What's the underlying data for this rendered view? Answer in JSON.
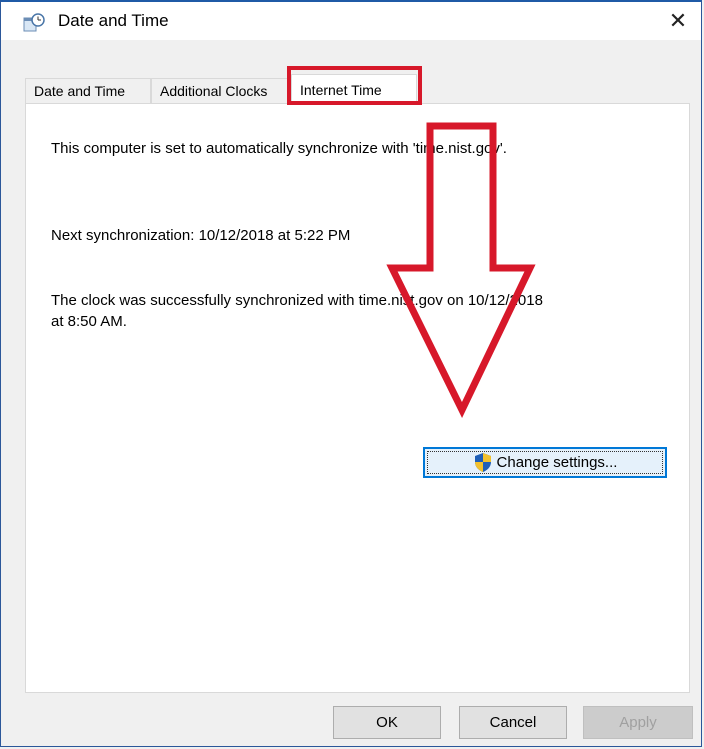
{
  "window": {
    "title": "Date and Time",
    "close_glyph": "✕"
  },
  "tabs": [
    {
      "label": "Date and Time",
      "active": false
    },
    {
      "label": "Additional Clocks",
      "active": false
    },
    {
      "label": "Internet Time",
      "active": true
    }
  ],
  "internet_time": {
    "sync_message": "This computer is set to automatically synchronize with 'time.nist.gov'.",
    "next_sync": "Next synchronization: 10/12/2018 at 5:22 PM",
    "last_sync_line1": "The clock was successfully synchronized with time.nist.gov on 10/12/2018",
    "last_sync_line2": "at 8:50 AM.",
    "change_settings_label": "Change settings..."
  },
  "footer": {
    "ok_label": "OK",
    "cancel_label": "Cancel",
    "apply_label": "Apply"
  },
  "colors": {
    "annotation_red": "#d7182a",
    "focus_blue": "#0078d7"
  },
  "icons": [
    "clock-icon",
    "close-icon",
    "uac-shield-icon"
  ]
}
